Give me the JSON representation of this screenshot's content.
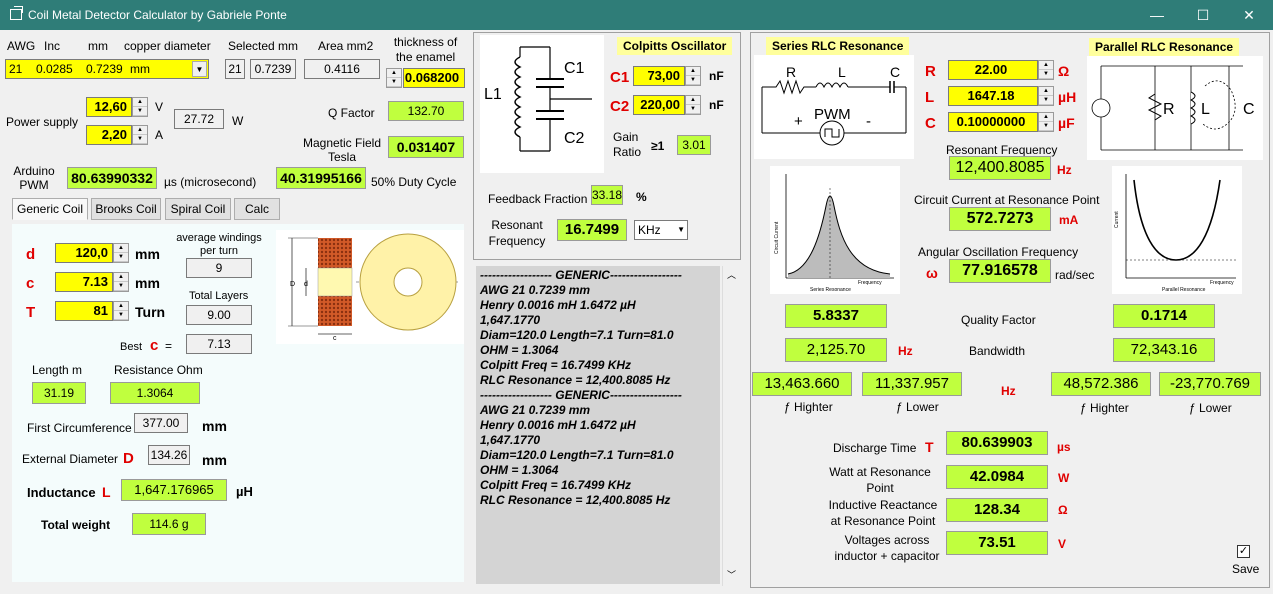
{
  "window": {
    "title": "Coil Metal Detector Calculator by Gabriele Ponte",
    "minimize": "—",
    "maximize": "☐",
    "close": "✕"
  },
  "wire": {
    "h_awg": "AWG",
    "h_inc": "Inc",
    "h_mm": "mm",
    "h_copper": "copper diameter",
    "awg": "21",
    "inc": "0.0285",
    "mm": "0.7239",
    "unit": "mm",
    "h_selected": "Selected mm",
    "sel_awg": "21",
    "sel_mm": "0.7239",
    "h_area": "Area mm2",
    "area": "0.4116",
    "h_thick": "thickness of the enamel",
    "thickness": "0.068200"
  },
  "power": {
    "label": "Power supply",
    "volts": "12,60",
    "volts_unit": "V",
    "amps": "2,20",
    "amps_unit": "A",
    "watts": "27.72",
    "watts_unit": "W",
    "q_label": "Q Factor",
    "q": "132.70",
    "mag_label": "Magnetic  Field Tesla",
    "mag": "0.031407",
    "arduino_label": "Arduino PWM",
    "pwm": "80.63990332",
    "pwm_unit": "µs (microsecond)",
    "duty": "40.31995166",
    "duty_label": "50% Duty Cycle"
  },
  "tabs": [
    "Generic Coil",
    "Brooks Coil",
    "Spiral Coil",
    "Calc"
  ],
  "coil": {
    "d_label": "d",
    "d": "120,0",
    "d_unit": "mm",
    "c_label": "c",
    "c": "7.13",
    "c_unit": "mm",
    "t_label": "T",
    "t": "81",
    "t_unit": "Turn",
    "avg_label": "average windings per turn",
    "avg": "9",
    "layers_label": "Total Layers",
    "layers": "9.00",
    "best_label": "Best",
    "best_c": "c",
    "best_eq": "=",
    "best": "7.13",
    "len_label": "Length m",
    "len": "31.19",
    "res_label": "Resistance Ohm",
    "res": "1.3064",
    "circ_label": "First Circumference",
    "circ": "377.00",
    "circ_unit": "mm",
    "ext_label": "External Diameter",
    "ext_D": "D",
    "ext": "134.26",
    "ext_unit": "mm",
    "ind_label": "Inductance",
    "ind_L": "L",
    "ind": "1,647.176965",
    "ind_unit": "µH",
    "weight_label": "Total weight",
    "weight": "114.6  g"
  },
  "coil_drawing": {
    "d": "d",
    "D": "D",
    "c": "c"
  },
  "colpitts": {
    "title": "Colpitts Oscillator",
    "c1_label": "C1",
    "c1": "73,00",
    "c1_unit": "nF",
    "c2_label": "C2",
    "c2": "220,00",
    "c2_unit": "nF",
    "gain_label": "Gain Ratio",
    "gain_ge": "≥1",
    "gain": "3.01",
    "fb_label": "Feedback Fraction",
    "fb": "33.18",
    "fb_unit": "%",
    "rf_label": "Resonant Frequency",
    "rf": "16.7499",
    "rf_unit": "KHz",
    "schem_l1": "L1",
    "schem_c1": "C1",
    "schem_c2": "C2"
  },
  "log": [
    "------------------ GENERIC------------------",
    "AWG  21       0.7239 mm",
    "Henry 0.0016    mH 1.6472    µH",
    "1,647.1770",
    "Diam=120.0   Length=7.1   Turn=81.0",
    "OHM = 1.3064",
    "Colpitt Freq = 16.7499 KHz",
    "RLC Resonance = 12,400.8085 Hz",
    "------------------ GENERIC------------------",
    "AWG  21       0.7239 mm",
    "Henry 0.0016    mH 1.6472    µH",
    "1,647.1770",
    "Diam=120.0   Length=7.1   Turn=81.0",
    "OHM = 1.3064",
    "Colpitt Freq = 16.7499 KHz",
    "RLC Resonance = 12,400.8085 Hz"
  ],
  "rlc": {
    "series_title": "Series RLC Resonance",
    "parallel_title": "Parallel RLC Resonance",
    "r_label": "R",
    "r": "22.00",
    "r_unit": "Ω",
    "l_label": "L",
    "l": "1647.18",
    "l_unit": "µH",
    "c_label": "C",
    "c": "0.10000000",
    "c_unit": "µF",
    "resfreq_label": "Resonant Frequency",
    "resfreq": "12,400.8085",
    "resfreq_unit": "Hz",
    "current_label": "Circuit Current at Resonance Point",
    "current": "572.7273",
    "current_unit": "mA",
    "angular_label": "Angular Oscillation Frequency",
    "omega": "ω",
    "angular": "77.916578",
    "angular_unit": "rad/sec",
    "q_label": "Quality Factor",
    "q_series": "5.8337",
    "q_parallel": "0.1714",
    "bw_label": "Bandwidth",
    "bw_series": "2,125.70",
    "bw_unit": "Hz",
    "bw_parallel": "72,343.16",
    "f_hz": "Hz",
    "s_fh": "13,463.660",
    "s_fl": "11,337.957",
    "p_fh": "48,572.386",
    "p_fl": "-23,770.769",
    "fh_label": "ƒ Highter",
    "fl_label": "ƒ Lower",
    "discharge_label": "Discharge Time",
    "discharge_T": "T",
    "discharge": "80.639903",
    "discharge_unit": "µs",
    "watt_label": "Watt at Resonance Point",
    "watt": "42.0984",
    "watt_unit": "W",
    "react_label": "Inductive  Reactance at Resonance Point",
    "react": "128.34",
    "react_unit": "Ω",
    "volt_label": "Voltages  across inductor + capacitor",
    "volt": "73.51",
    "volt_unit": "V",
    "save_label": "Save",
    "save_check": "✓",
    "series_schem": {
      "r": "R",
      "l": "L",
      "c": "C",
      "plus": "+",
      "pwm": "PWM",
      "minus": "-"
    },
    "parallel_schem": {
      "r": "R",
      "l": "L",
      "c": "C"
    },
    "series_plot": {
      "xlabel": "Frequency",
      "ylabel": "Circuit Current",
      "caption": "Series Resonance"
    },
    "parallel_plot": {
      "xlabel": "Frequency",
      "ylabel": "Current",
      "caption": "Parallel Resonance"
    }
  }
}
